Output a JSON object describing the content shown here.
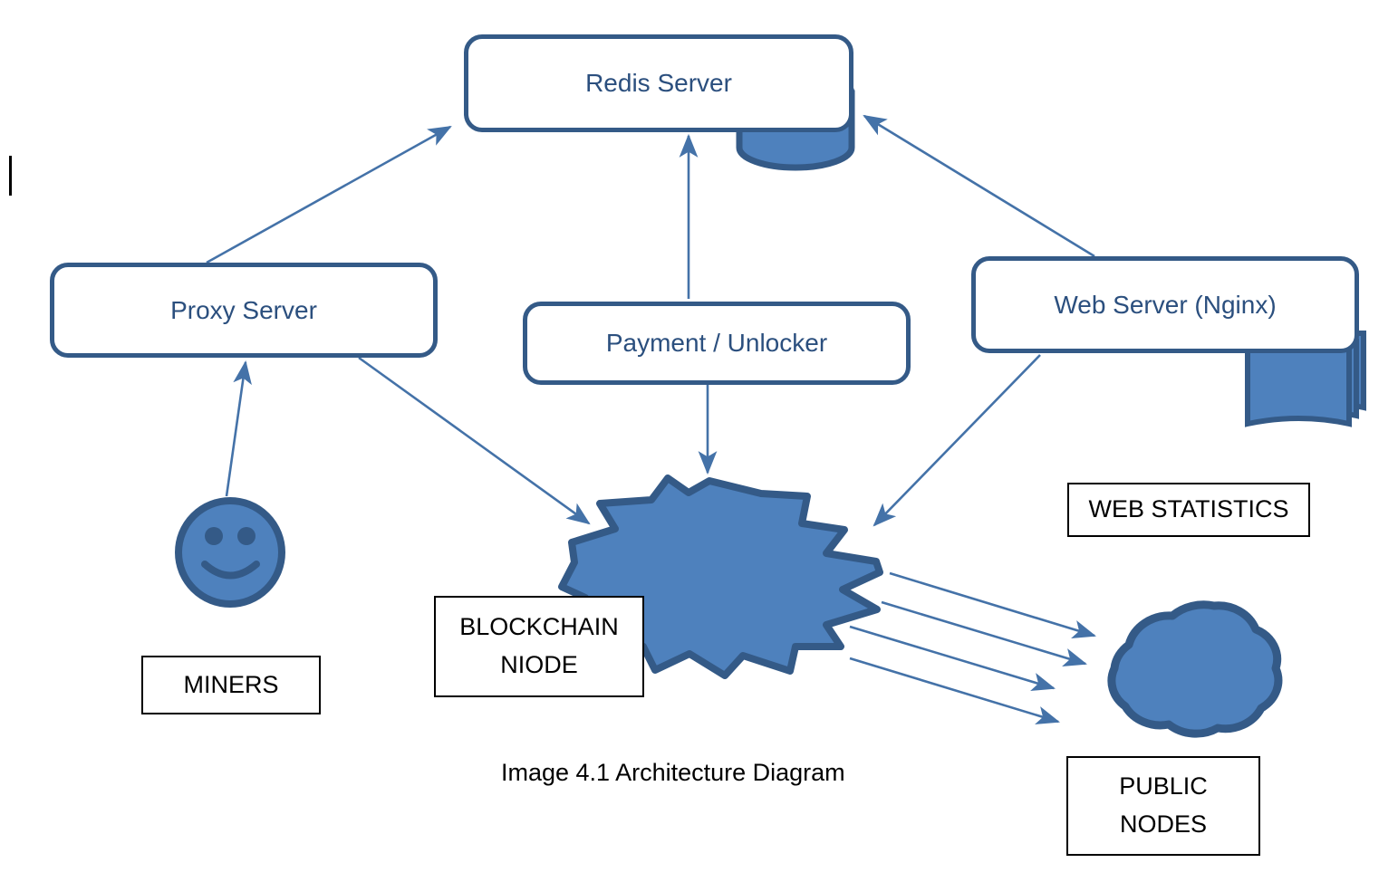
{
  "diagram": {
    "caption": "Image 4.1 Architecture Diagram",
    "colors": {
      "shape_fill": "#4e81bd",
      "shape_outline": "#345a87",
      "box_border": "#345a87",
      "box_text": "#2b4f7e",
      "arrow": "#4472a8",
      "caption_text": "#000000",
      "background": "#ffffff"
    },
    "nodes": {
      "redis": {
        "label": "Redis Server",
        "icon": "database-cylinder-icon"
      },
      "proxy": {
        "label": "Proxy Server"
      },
      "payment": {
        "label": "Payment / Unlocker"
      },
      "webserver": {
        "label": "Web Server (Nginx)",
        "icon": "stacked-documents-icon"
      },
      "miners": {
        "label": "MINERS",
        "icon": "smiley-face-icon"
      },
      "blockchain": {
        "label_line1": "BLOCKCHAIN",
        "label_line2": "NIODE",
        "icon": "burst-star-icon"
      },
      "webstats": {
        "label": "WEB STATISTICS"
      },
      "publicnodes": {
        "label_line1": "PUBLIC",
        "label_line2": "NODES",
        "icon": "cloud-icon"
      }
    },
    "edges": [
      {
        "from": "proxy",
        "to": "redis",
        "style": "single-arrow"
      },
      {
        "from": "payment",
        "to": "redis",
        "style": "single-arrow"
      },
      {
        "from": "webserver",
        "to": "redis",
        "style": "single-arrow"
      },
      {
        "from": "miners",
        "to": "proxy",
        "style": "single-arrow"
      },
      {
        "from": "proxy",
        "to": "blockchain",
        "style": "single-arrow"
      },
      {
        "from": "payment",
        "to": "blockchain",
        "style": "single-arrow"
      },
      {
        "from": "webserver",
        "to": "blockchain",
        "style": "single-arrow"
      },
      {
        "from": "blockchain",
        "to": "publicnodes",
        "style": "single-arrow"
      },
      {
        "from": "blockchain",
        "to": "publicnodes",
        "style": "single-arrow"
      },
      {
        "from": "blockchain",
        "to": "publicnodes",
        "style": "single-arrow"
      },
      {
        "from": "blockchain",
        "to": "publicnodes",
        "style": "single-arrow"
      }
    ]
  }
}
